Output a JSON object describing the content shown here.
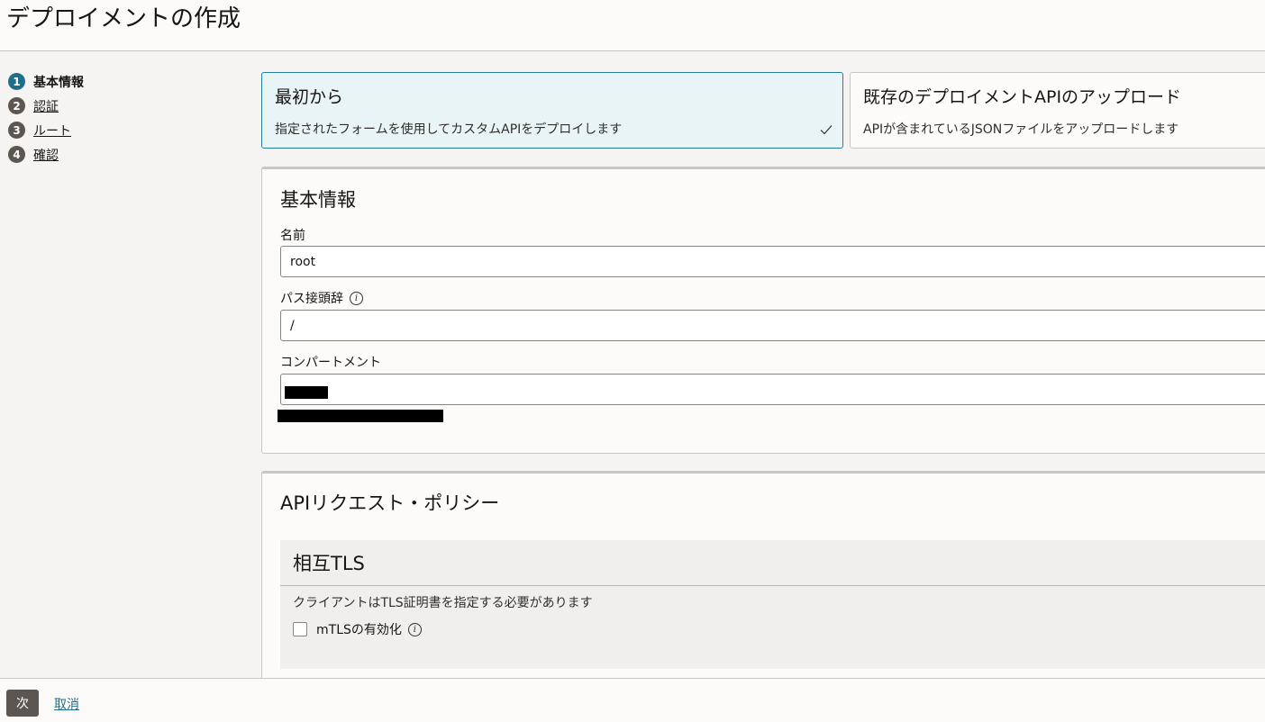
{
  "page": {
    "title": "デプロイメントの作成"
  },
  "steps": [
    {
      "number": "1",
      "label": "基本情報"
    },
    {
      "number": "2",
      "label": "認証"
    },
    {
      "number": "3",
      "label": "ルート"
    },
    {
      "number": "4",
      "label": "確認"
    }
  ],
  "options": [
    {
      "title": "最初から",
      "description": "指定されたフォームを使用してカスタムAPIをデプロイします",
      "selected": true
    },
    {
      "title": "既存のデプロイメントAPIのアップロード",
      "description": "APIが含まれているJSONファイルをアップロードします",
      "selected": false
    }
  ],
  "basic_info": {
    "title": "基本情報",
    "name_label": "名前",
    "name_value": "root",
    "path_prefix_label": "パス接頭辞",
    "path_prefix_value": "/",
    "compartment_label": "コンパートメント"
  },
  "api_policy": {
    "title": "APIリクエスト・ポリシー",
    "mtls": {
      "title": "相互TLS",
      "description": "クライアントはTLS証明書を指定する必要があります",
      "checkbox_label": "mTLSの有効化",
      "checked": false
    }
  },
  "footer": {
    "next_label": "次",
    "cancel_label": "取消"
  },
  "colors": {
    "accent": "#227e9e",
    "step_active": "#1f6f8b",
    "button": "#5b5652"
  }
}
